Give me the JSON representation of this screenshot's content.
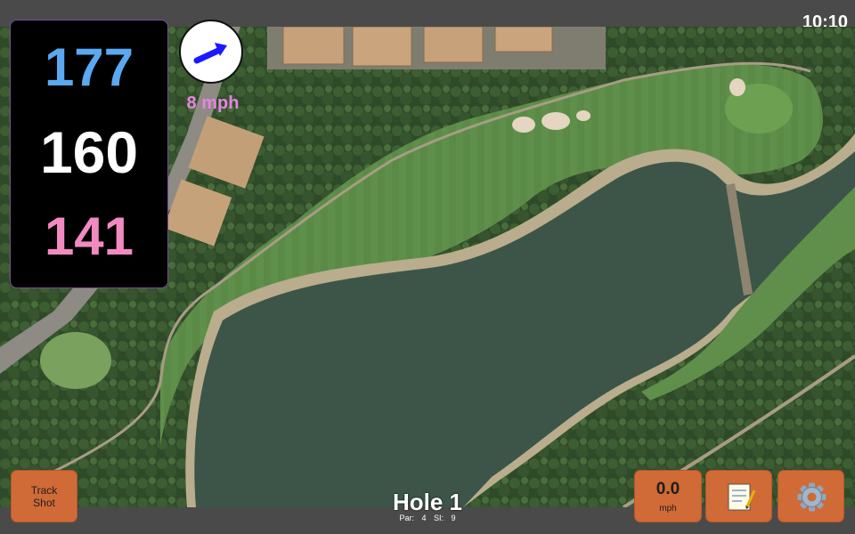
{
  "status": {
    "clock": "10:10"
  },
  "yardages": {
    "back": "177",
    "middle": "160",
    "front": "141"
  },
  "wind": {
    "speed": "8 mph",
    "icon": "wind-arrow-icon"
  },
  "hole": {
    "title": "Hole 1",
    "par": "Par: 4",
    "stroke_index": "SI: 9"
  },
  "buttons": {
    "track_shot_line1": "Track",
    "track_shot_line2": "Shot",
    "speed_value": "0.0",
    "speed_unit": "mph",
    "notes_icon": "notepad-icon",
    "settings_icon": "gear-icon"
  },
  "colors": {
    "back_yardage": "#5aa9f0",
    "middle_yardage": "#ffffff",
    "front_yardage": "#f28ac2",
    "wind_speed": "#e585e0",
    "button": "#d06a36"
  }
}
